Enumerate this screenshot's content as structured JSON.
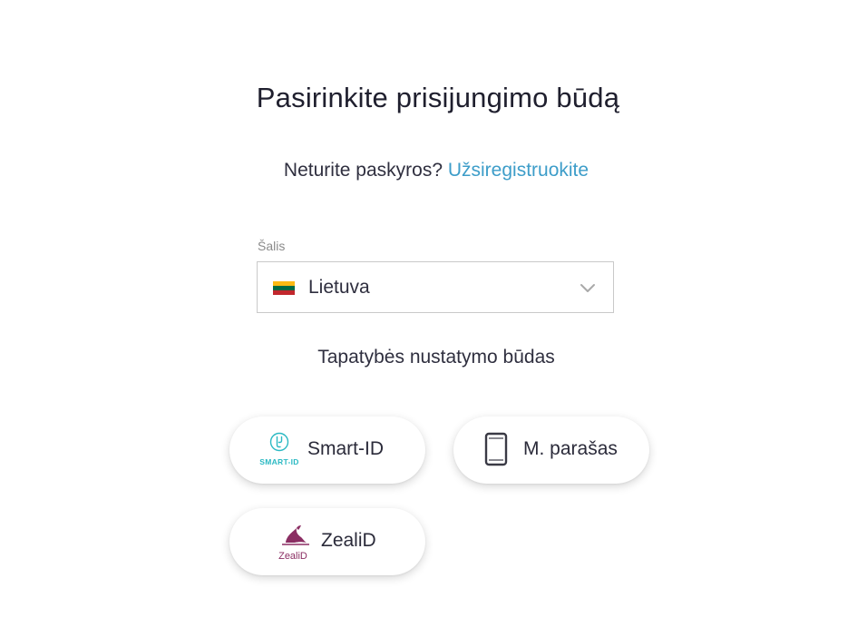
{
  "header": {
    "title": "Pasirinkite prisijungimo būdą"
  },
  "register": {
    "prompt": "Neturite paskyros?",
    "link_label": "Užsiregistruokite"
  },
  "country": {
    "label": "Šalis",
    "selected": "Lietuva",
    "flag_colors": [
      "#FDB913",
      "#006A44",
      "#C1272D"
    ]
  },
  "auth": {
    "heading": "Tapatybės nustatymo būdas",
    "methods": [
      {
        "label": "Smart-ID",
        "icon": "smart-id-logo",
        "logo_text": "SMART-ID",
        "color": "#2bb9c3"
      },
      {
        "label": "M. parašas",
        "icon": "mobile-phone-icon"
      },
      {
        "label": "ZealiD",
        "icon": "zealid-logo",
        "logo_text": "ZealiD",
        "color": "#8b2e63"
      }
    ]
  }
}
